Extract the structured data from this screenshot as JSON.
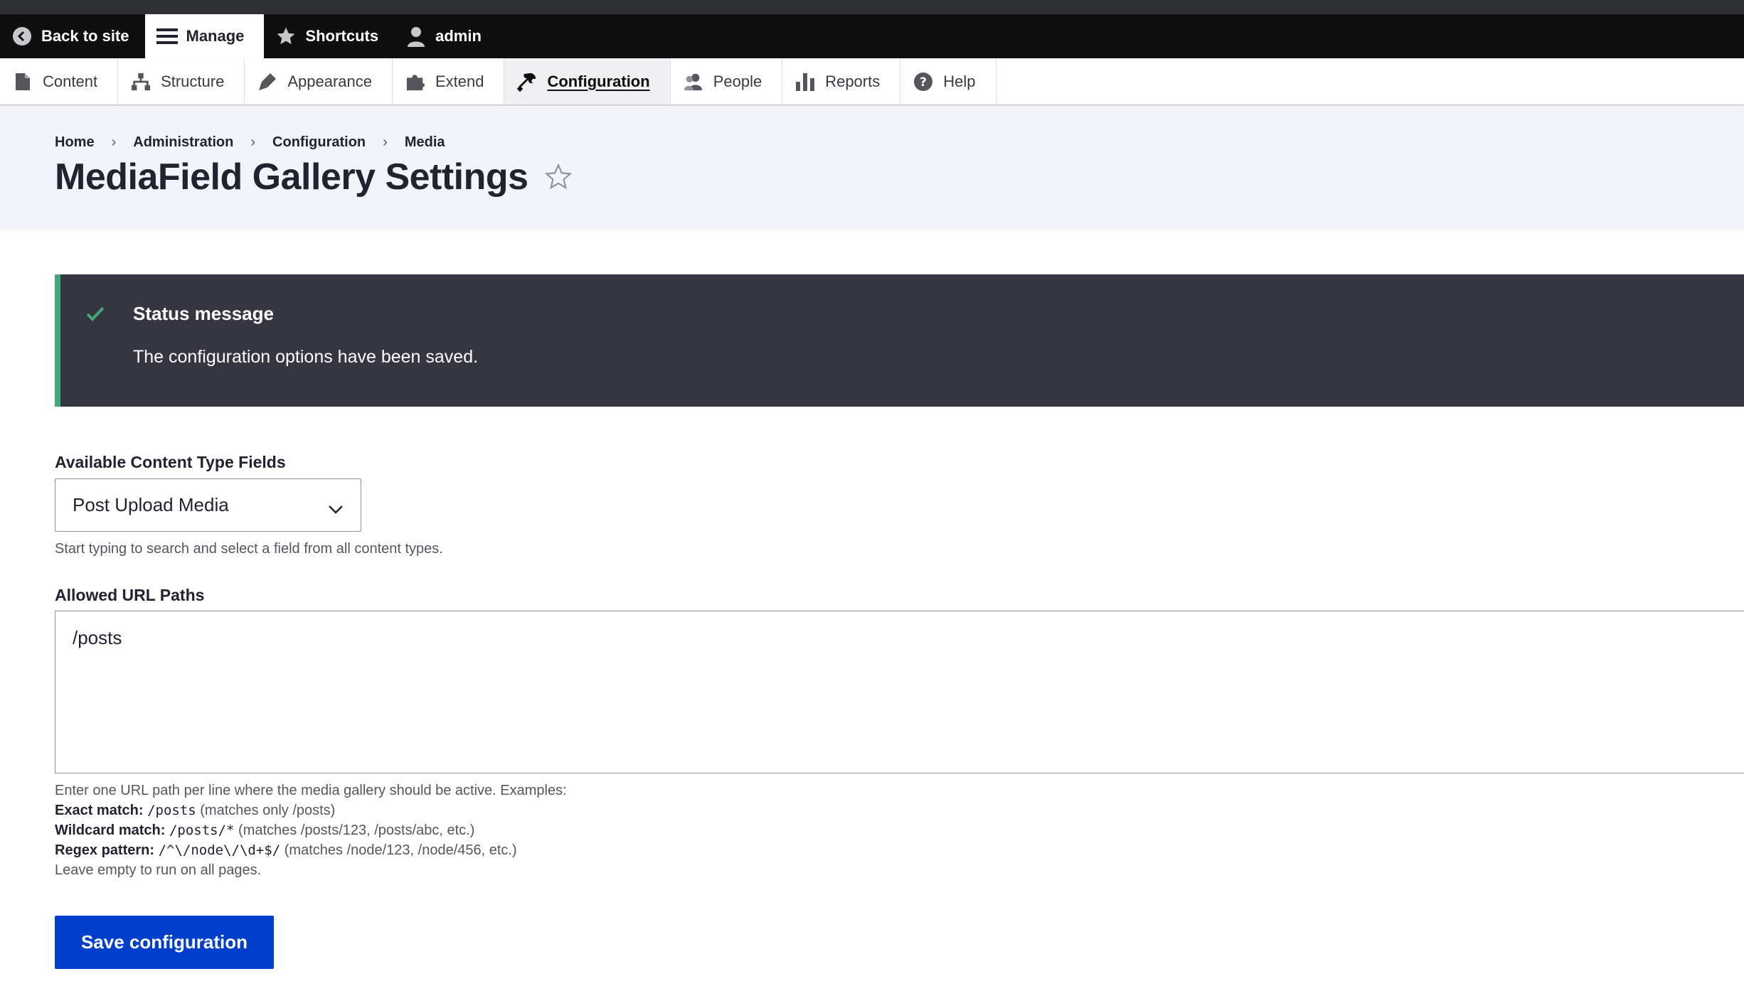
{
  "toolbar": {
    "back_to_site": "Back to site",
    "manage": "Manage",
    "shortcuts": "Shortcuts",
    "user": "admin"
  },
  "tray": {
    "items": [
      {
        "label": "Content",
        "icon": "file-icon"
      },
      {
        "label": "Structure",
        "icon": "sitemap-icon"
      },
      {
        "label": "Appearance",
        "icon": "paintbrush-icon"
      },
      {
        "label": "Extend",
        "icon": "puzzle-icon"
      },
      {
        "label": "Configuration",
        "icon": "wrench-icon",
        "current": true
      },
      {
        "label": "People",
        "icon": "people-icon"
      },
      {
        "label": "Reports",
        "icon": "bar-chart-icon"
      },
      {
        "label": "Help",
        "icon": "help-icon"
      }
    ]
  },
  "breadcrumb": [
    "Home",
    "Administration",
    "Configuration",
    "Media"
  ],
  "page": {
    "title": "MediaField Gallery Settings"
  },
  "status": {
    "title": "Status message",
    "text": "The configuration options have been saved."
  },
  "form": {
    "content_type_fields": {
      "label": "Available Content Type Fields",
      "value": "Post Upload Media",
      "description": "Start typing to search and select a field from all content types."
    },
    "allowed_paths": {
      "label": "Allowed URL Paths",
      "value": "/posts",
      "intro": "Enter one URL path per line where the media gallery should be active. Examples:",
      "exact_label": "Exact match:",
      "exact_code": "/posts",
      "exact_note": "(matches only /posts)",
      "wildcard_label": "Wildcard match:",
      "wildcard_code": "/posts/*",
      "wildcard_note": "(matches /posts/123, /posts/abc, etc.)",
      "regex_label": "Regex pattern:",
      "regex_code": "/^\\/node\\/\\d+$/",
      "regex_note": "(matches /node/123, /node/456, etc.)",
      "empty_note": "Leave empty to run on all pages."
    },
    "save_label": "Save configuration"
  },
  "colors": {
    "toolbar_bg": "#0f0f0f",
    "status_bg": "#353641",
    "status_accent": "#42a877",
    "button_primary": "#003ecc"
  }
}
